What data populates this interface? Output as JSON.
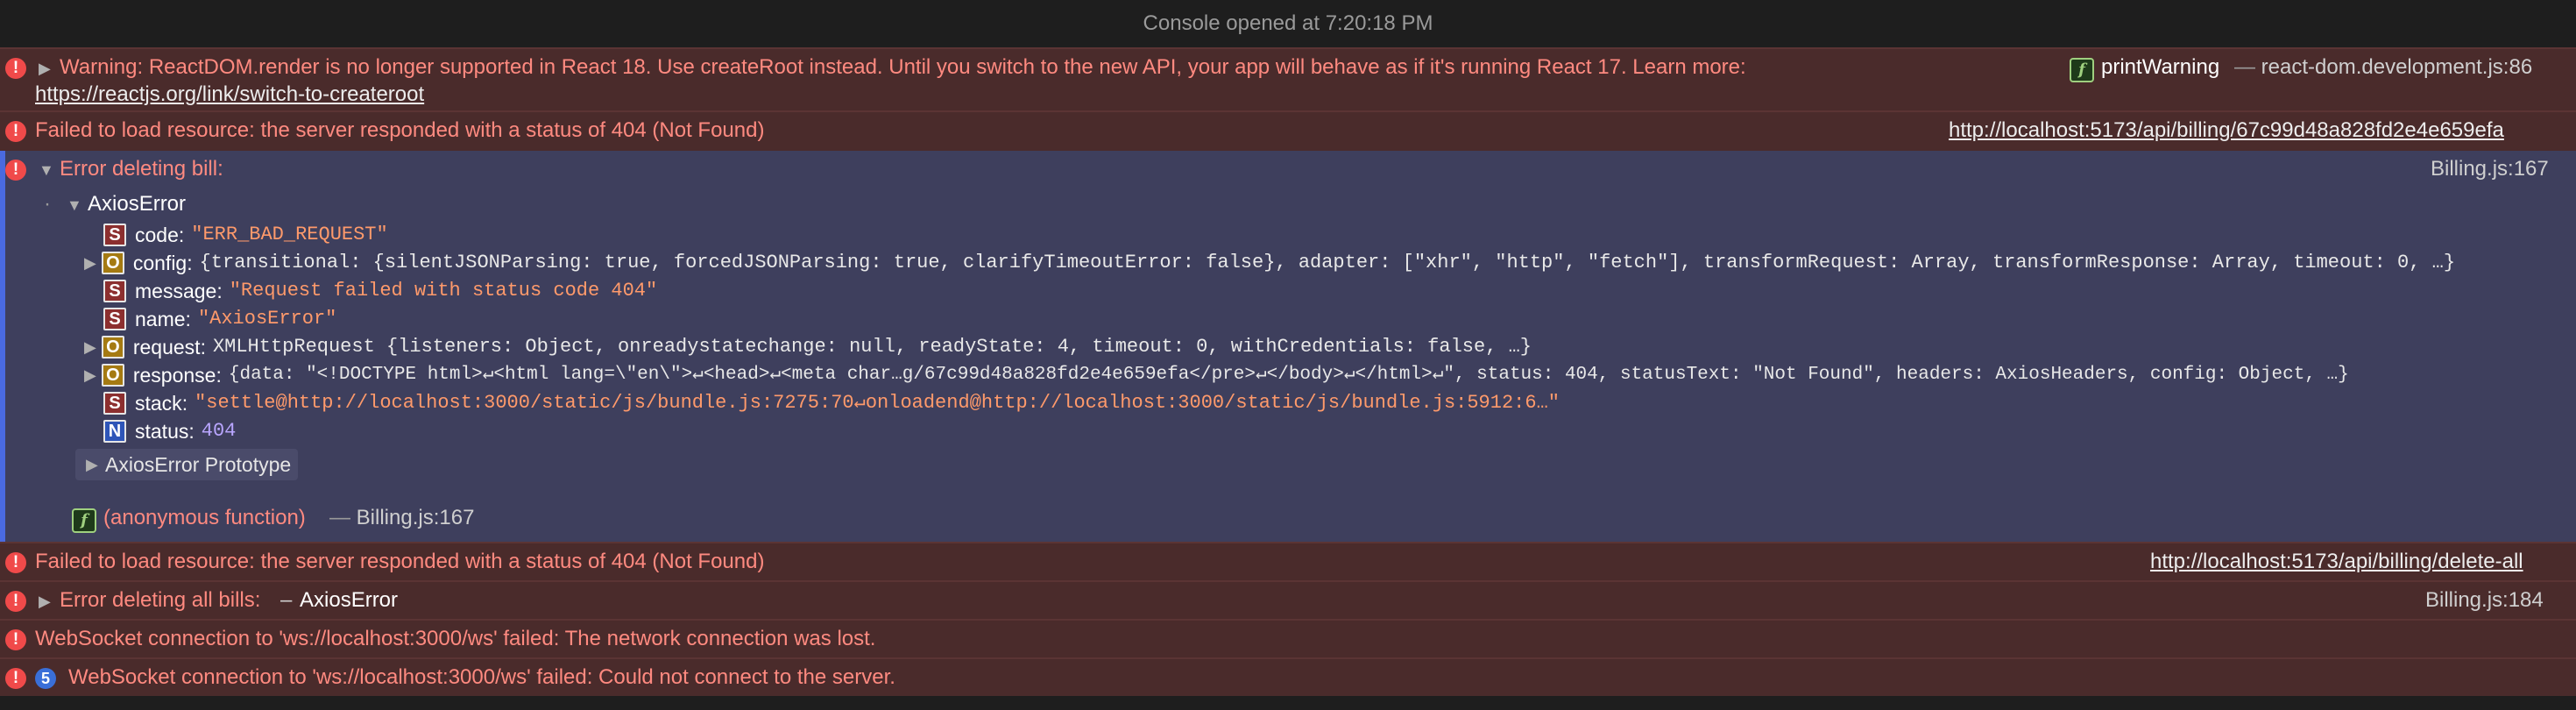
{
  "header": {
    "title": "Console opened at 7:20:18 PM"
  },
  "messages": {
    "warning": {
      "text": "Warning: ReactDOM.render is no longer supported in React 18. Use createRoot instead. Until you switch to the new API, your app will behave as if it's running React 17. Learn more:",
      "link": "https://reactjs.org/link/switch-to-createroot",
      "function_name": "printWarning",
      "source": "react-dom.development.js:86"
    },
    "fail1": {
      "text": "Failed to load resource: the server responded with a status of 404 (Not Found)",
      "url": "http://localhost:5173/api/billing/67c99d48a828fd2e4e659efa"
    },
    "error_group": {
      "title": "Error deleting bill:",
      "source": "Billing.js:167",
      "object_name": "AxiosError",
      "props": {
        "code_key": "code",
        "code_val": "\"ERR_BAD_REQUEST\"",
        "config_key": "config",
        "config_val": "{transitional: {silentJSONParsing: true, forcedJSONParsing: true, clarifyTimeoutError: false}, adapter: [\"xhr\", \"http\", \"fetch\"], transformRequest: Array, transformResponse: Array, timeout: 0, …}",
        "message_key": "message",
        "message_val": "\"Request failed with status code 404\"",
        "name_key": "name",
        "name_val": "\"AxiosError\"",
        "request_key": "request",
        "request_val": "XMLHttpRequest {listeners: Object, onreadystatechange: null, readyState: 4, timeout: 0, withCredentials: false, …}",
        "response_key": "response",
        "response_val": "{data: \"<!DOCTYPE html>↵<html lang=\\\"en\\\">↵<head>↵<meta char…g/67c99d48a828fd2e4e659efa</pre>↵</body>↵</html>↵\", status: 404, statusText: \"Not Found\", headers: AxiosHeaders, config: Object, …}",
        "stack_key": "stack",
        "stack_val": "\"settle@http://localhost:3000/static/js/bundle.js:7275:70↵onloadend@http://localhost:3000/static/js/bundle.js:5912:6…\"",
        "status_key": "status",
        "status_val": "404"
      },
      "badges": {
        "string": "S",
        "object": "O",
        "number": "N"
      },
      "prototype_label": "AxiosError Prototype",
      "function_name": "(anonymous function)",
      "function_source": "Billing.js:167",
      "f_badge": "f"
    },
    "fail2": {
      "text": "Failed to load resource: the server responded with a status of 404 (Not Found)",
      "url": "http://localhost:5173/api/billing/delete-all"
    },
    "error_all": {
      "title": "Error deleting all bills:",
      "dash": "–",
      "object_name": "AxiosError",
      "source": "Billing.js:184"
    },
    "ws1": {
      "text": "WebSocket connection to 'ws://localhost:3000/ws' failed: The network connection was lost."
    },
    "ws2": {
      "count": "5",
      "text": "WebSocket connection to 'ws://localhost:3000/ws' failed: Could not connect to the server."
    }
  },
  "colors": {
    "error_bg": "#4a2b2b",
    "selected_bg": "#3e3f5d",
    "accent_blue": "#4a6ae0",
    "error_text": "#ff8a80"
  },
  "icons": [
    "error-icon",
    "disclosure-triangle-icon",
    "function-icon",
    "string-type-icon",
    "object-type-icon",
    "number-type-icon",
    "repeat-count-badge"
  ]
}
